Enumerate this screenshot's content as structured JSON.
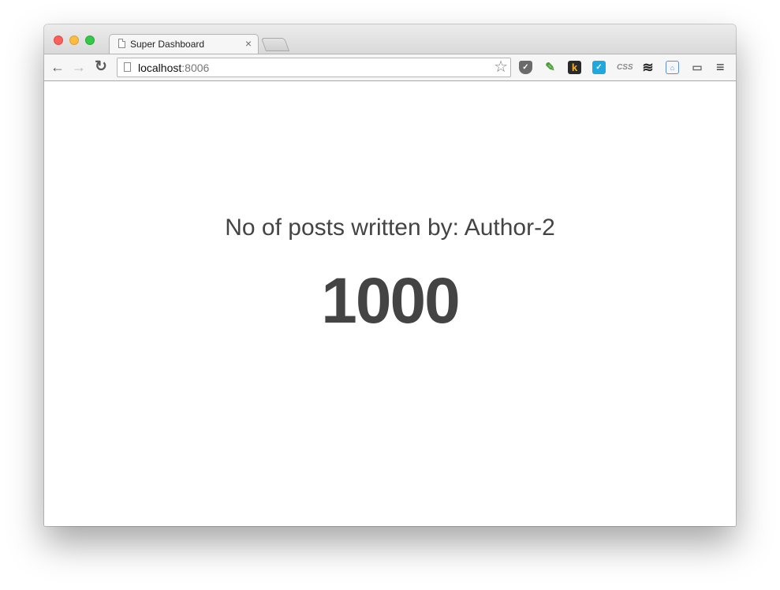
{
  "browser": {
    "tab": {
      "title": "Super Dashboard",
      "close_glyph": "×"
    },
    "address_bar": {
      "host": "localhost",
      "port": ":8006"
    },
    "nav_icons": {
      "back": "back-arrow-icon",
      "forward": "forward-arrow-icon",
      "reload": "reload-icon"
    },
    "extensions": [
      {
        "name": "pocket-icon",
        "glyph": "✓"
      },
      {
        "name": "evernote-clipper-icon",
        "glyph": "✎"
      },
      {
        "name": "k-extension-icon",
        "glyph": "k"
      },
      {
        "name": "checkmark-extension-icon",
        "glyph": "✓"
      },
      {
        "name": "css-extension-icon",
        "glyph": "CSS"
      },
      {
        "name": "buffer-icon",
        "glyph": "≋"
      },
      {
        "name": "folder-extension-icon",
        "glyph": "⌂"
      },
      {
        "name": "cast-icon",
        "glyph": "▭"
      }
    ],
    "menu_glyph": "≡",
    "colors": {
      "close": "#fc605c",
      "minimize": "#fdbc40",
      "maximize": "#34c84a"
    }
  },
  "page": {
    "label": "No of posts written by: Author-2",
    "count": "1000"
  }
}
